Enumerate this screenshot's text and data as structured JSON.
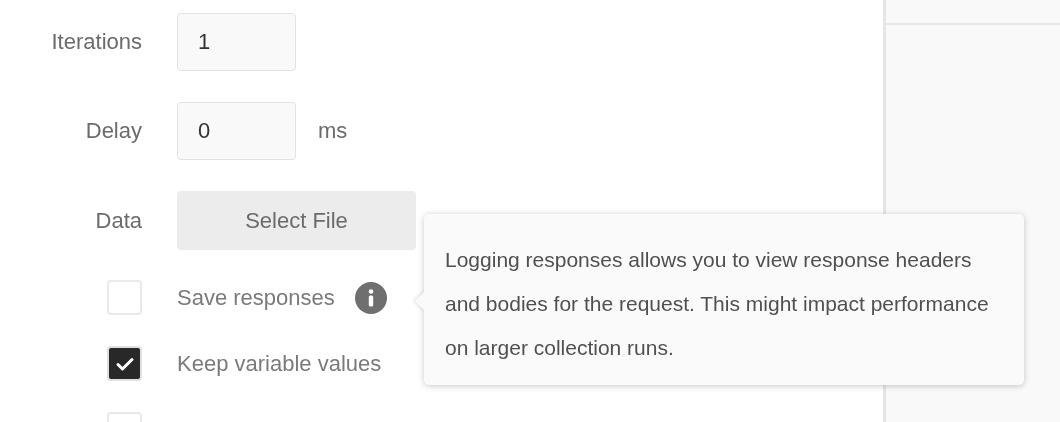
{
  "form": {
    "fields": [
      {
        "kind": "input",
        "label": "Iterations",
        "value": "1"
      },
      {
        "kind": "input",
        "label": "Delay",
        "value": "0",
        "unit": "ms"
      },
      {
        "kind": "file",
        "label": "Data",
        "button": "Select File"
      }
    ],
    "options": [
      {
        "label": "Save responses",
        "checked": false,
        "info": true
      },
      {
        "label": "Keep variable values",
        "checked": true
      },
      {
        "checked": false
      }
    ]
  },
  "tooltip": {
    "text": "Logging responses allows you to view response headers and bodies for the request. This might impact performance on larger collection runs."
  }
}
